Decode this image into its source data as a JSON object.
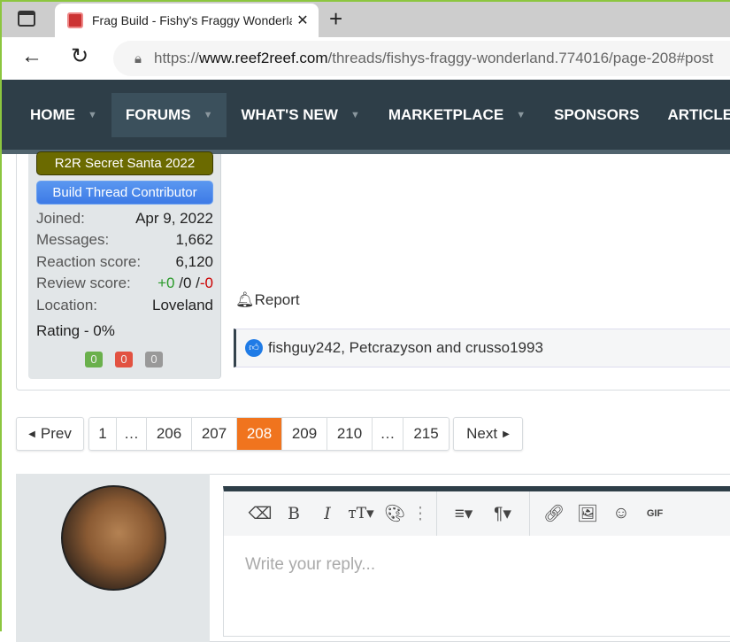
{
  "browser": {
    "tab_title": "Frag Build - Fishy's Fraggy Wonderland",
    "url_prefix": "https://",
    "url_domain": "www.reef2reef.com",
    "url_path": "/threads/fishys-fraggy-wonderland.774016/page-208#post"
  },
  "nav": {
    "items": [
      {
        "label": "HOME",
        "dropdown": true
      },
      {
        "label": "FORUMS",
        "dropdown": true,
        "active": true
      },
      {
        "label": "WHAT'S NEW",
        "dropdown": true
      },
      {
        "label": "MARKETPLACE",
        "dropdown": true
      },
      {
        "label": "SPONSORS",
        "dropdown": false
      },
      {
        "label": "ARTICLES",
        "dropdown": false
      }
    ]
  },
  "user": {
    "banner1": "R2R Secret Santa 2022",
    "banner2": "Build Thread Contributor",
    "joined_label": "Joined:",
    "joined": "Apr 9, 2022",
    "messages_label": "Messages:",
    "messages": "1,662",
    "reaction_label": "Reaction score:",
    "reaction": "6,120",
    "review_label": "Review score:",
    "review_pos": "+0",
    "review_mid": " /0 /",
    "review_neg": "-0",
    "location_label": "Location:",
    "location": "Loveland",
    "rating": "Rating - 0%",
    "pills": [
      "0",
      "0",
      "0"
    ]
  },
  "post": {
    "report": "Report",
    "likes": "fishguy242, Petcrazyson and crusso1993"
  },
  "pagination": {
    "prev": "Prev",
    "next": "Next",
    "pages": [
      "1",
      "…",
      "206",
      "207",
      "208",
      "209",
      "210",
      "…",
      "215"
    ],
    "current": "208"
  },
  "editor": {
    "placeholder": "Write your reply...",
    "gif": "GIF"
  },
  "colors": {
    "nav_bg": "#2e3e48",
    "current_page": "#f0741e",
    "accent_green": "#8cc63f"
  }
}
